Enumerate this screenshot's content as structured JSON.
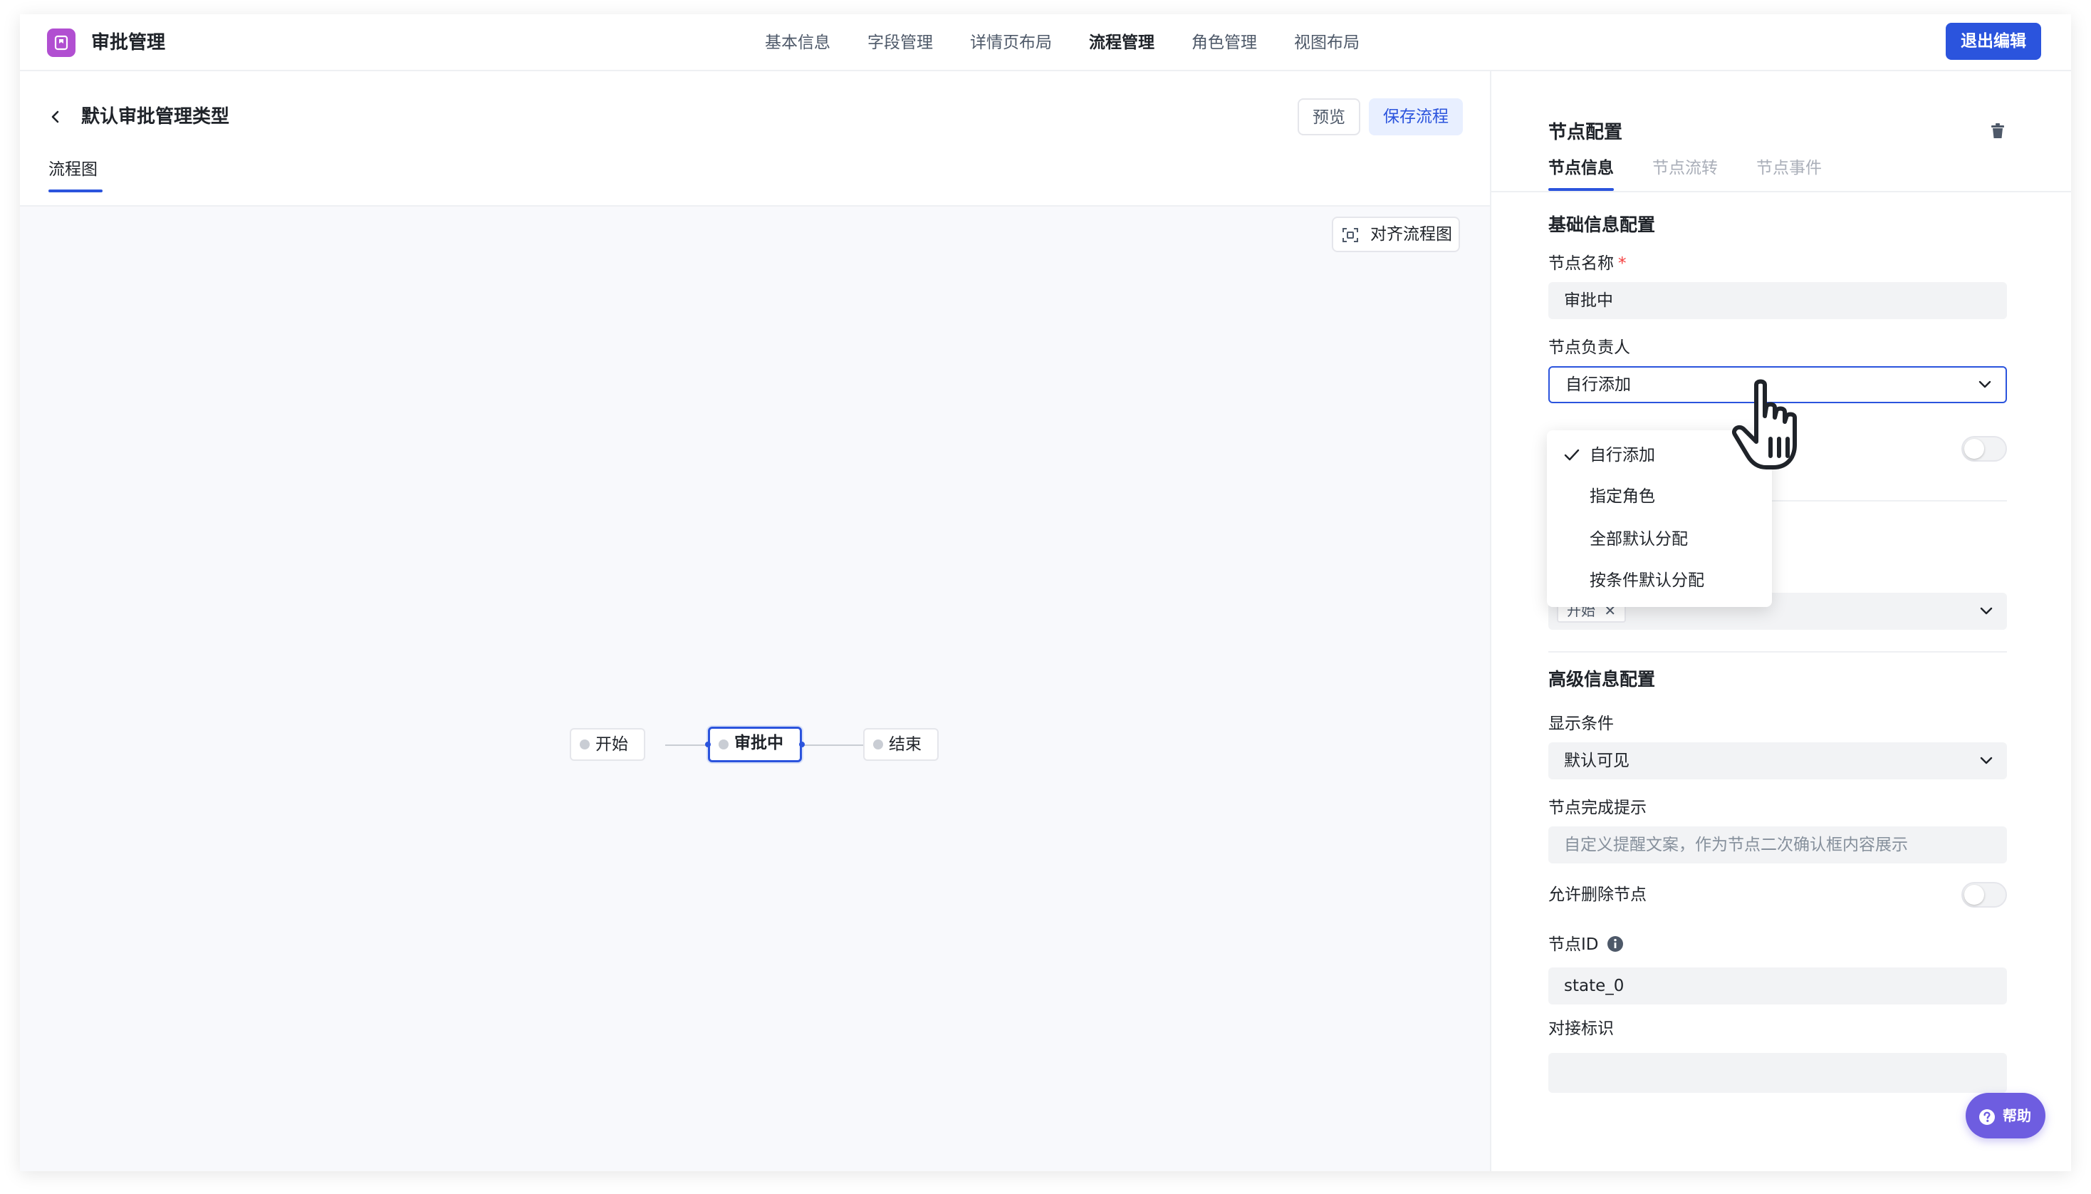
{
  "app": {
    "title": "审批管理",
    "logo_icon": "bookmark-icon",
    "accent": "#2b54dd",
    "logo_color": "#b14fd1"
  },
  "nav": {
    "items": [
      "基本信息",
      "字段管理",
      "详情页布局",
      "流程管理",
      "角色管理",
      "视图布局"
    ],
    "active": "流程管理"
  },
  "exit_button": "退出编辑",
  "left": {
    "back_icon": "chevron-left-icon",
    "title": "默认审批管理类型",
    "preview_button": "预览",
    "save_button": "保存流程",
    "tab": "流程图",
    "align_button": "对齐流程图",
    "nodes": [
      "开始",
      "审批中",
      "结束"
    ],
    "selected_node": "审批中"
  },
  "right": {
    "title": "节点配置",
    "delete_icon": "trash-icon",
    "tabs": [
      "节点信息",
      "节点流转",
      "节点事件"
    ],
    "active_tab": "节点信息",
    "basic_section": "基础信息配置",
    "node_name_label": "节点名称",
    "required_mark": "*",
    "node_name_value": "审批中",
    "owner_label": "节点负责人",
    "owner_value": "自行添加",
    "owner_options": [
      "自行添加",
      "指定角色",
      "全部默认分配",
      "按条件默认分配"
    ],
    "owner_selected": "自行添加",
    "hidden_toggle_on": false,
    "source_tag": "开始",
    "advanced_section": "高级信息配置",
    "display_condition_label": "显示条件",
    "display_condition_value": "默认可见",
    "completion_hint_label": "节点完成提示",
    "completion_hint_placeholder": "自定义提醒文案，作为节点二次确认框内容展示",
    "allow_delete_label": "允许删除节点",
    "allow_delete_on": false,
    "node_id_label": "节点ID",
    "node_id_value": "state_0",
    "integration_id_label": "对接标识",
    "integration_id_value": ""
  },
  "help_button": "帮助"
}
